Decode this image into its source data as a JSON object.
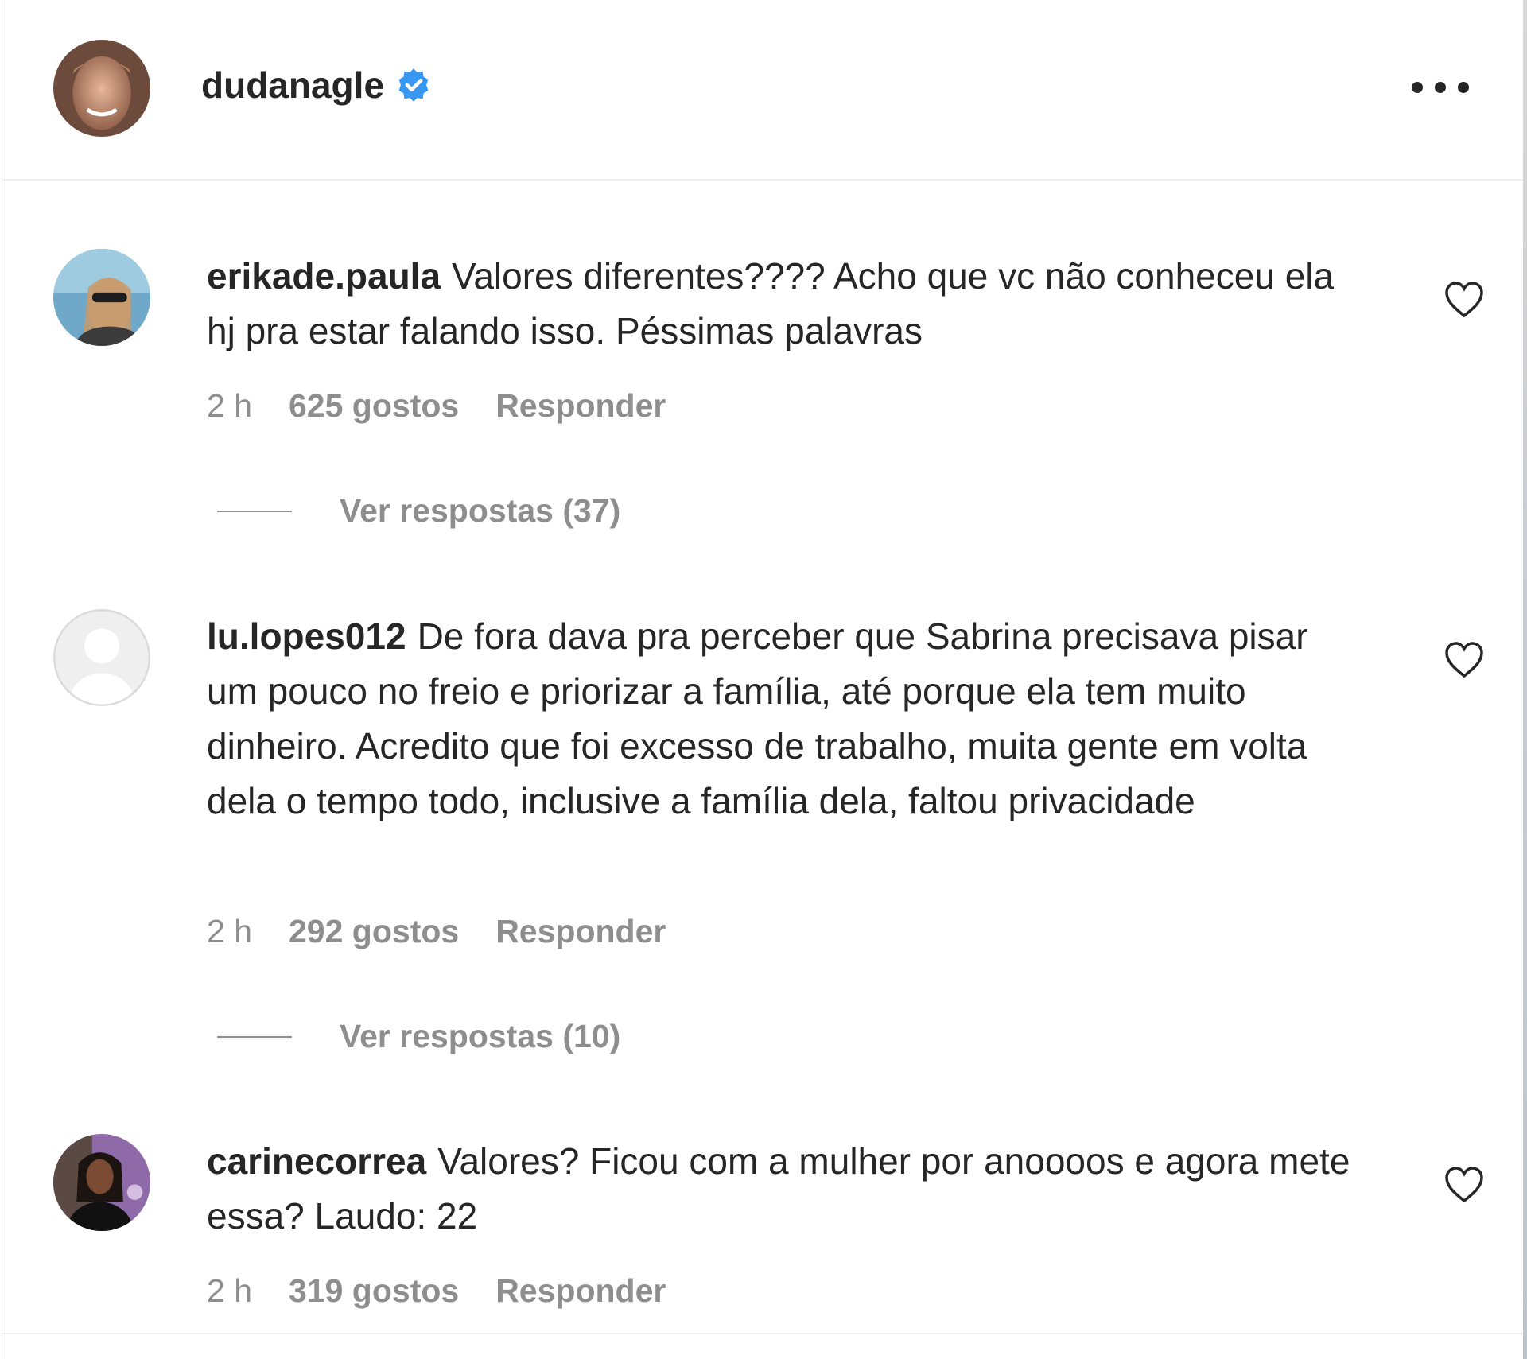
{
  "post_header": {
    "username": "dudanagle",
    "verified_icon": "verified-badge-icon",
    "more_icon": "more-options-icon"
  },
  "comments": [
    {
      "username": "erikade.paula",
      "text": "Valores diferentes???? Acho que vc não conheceu ela hj pra estar falando isso. Péssimas palavras",
      "time": "2 h",
      "likes": "625 gostos",
      "reply_label": "Responder",
      "view_replies": "Ver respostas (37)"
    },
    {
      "username": "lu.lopes012",
      "text": "De fora dava pra perceber que Sabrina precisava pisar um pouco no freio e priorizar a família, até porque ela tem muito dinheiro. Acredito que foi excesso de trabalho, muita gente em volta dela o tempo todo, inclusive a família dela, faltou privacidade",
      "time": "2 h",
      "likes": "292 gostos",
      "reply_label": "Responder",
      "view_replies": "Ver respostas (10)"
    },
    {
      "username": "carinecorrea",
      "text": "Valores? Ficou com a mulher por anoooos e agora mete essa? Laudo: 22",
      "time": "2 h",
      "likes": "319 gostos",
      "reply_label": "Responder"
    }
  ],
  "colors": {
    "text": "#262626",
    "secondary": "#8e8e8e",
    "verified": "#3897f0",
    "divider": "#efefef"
  }
}
